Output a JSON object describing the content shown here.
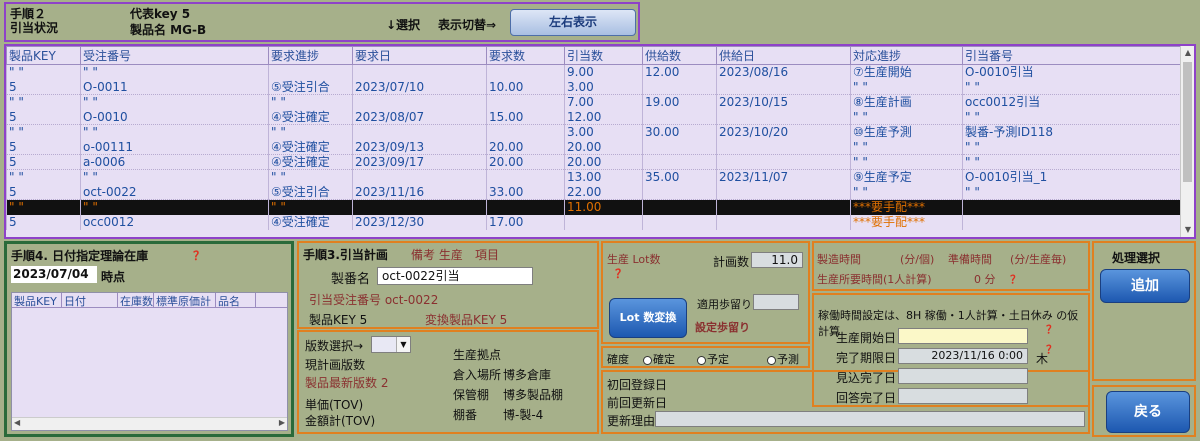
{
  "header": {
    "step_label": "手順２",
    "status_label": "引当状況",
    "rep_key": "代表key 5",
    "product_name": "製品名  MG-B",
    "select_label": "↓選択",
    "display_switch": "表示切替⇒",
    "lr_button": "左右表示"
  },
  "grid": {
    "columns": [
      "製品KEY",
      "受注番号",
      "要求進捗",
      "要求日",
      "要求数",
      "引当数",
      "供給数",
      "供給日",
      "対応進捗",
      "引当番号"
    ],
    "rows": [
      {
        "key": "\" \"",
        "order": "\" \"",
        "prog": "",
        "date": "",
        "qty": "",
        "alloc": "9.00",
        "supply": "12.00",
        "sdate": "2023/08/16",
        "resp": "⑦生産開始",
        "alno": "O-0010引当",
        "sep": false,
        "hl": false
      },
      {
        "key": "5",
        "order": "O-0011",
        "prog": "⑤受注引合",
        "date": "2023/07/10",
        "qty": "10.00",
        "alloc": "3.00",
        "supply": "",
        "sdate": "",
        "resp": "\"  \"",
        "alno": "\"  \"",
        "sep": true,
        "hl": false
      },
      {
        "key": "\"  \"",
        "order": "\" \"",
        "prog": "\" \"",
        "date": "",
        "qty": "",
        "alloc": "7.00",
        "supply": "19.00",
        "sdate": "2023/10/15",
        "resp": "⑧生産計画",
        "alno": "occ0012引当",
        "sep": false,
        "hl": false
      },
      {
        "key": "5",
        "order": "O-0010",
        "prog": "④受注確定",
        "date": "2023/08/07",
        "qty": "15.00",
        "alloc": "12.00",
        "supply": "",
        "sdate": "",
        "resp": "\"  \"",
        "alno": "\"  \"",
        "sep": true,
        "hl": false
      },
      {
        "key": "\"  \"",
        "order": "\" \"",
        "prog": "\" \"",
        "date": "",
        "qty": "",
        "alloc": "3.00",
        "supply": "30.00",
        "sdate": "2023/10/20",
        "resp": "⑩生産予測",
        "alno": "製番-予測ID118",
        "sep": false,
        "hl": false
      },
      {
        "key": "5",
        "order": "o-00111",
        "prog": "④受注確定",
        "date": "2023/09/13",
        "qty": "20.00",
        "alloc": "20.00",
        "supply": "",
        "sdate": "",
        "resp": "\"  \"",
        "alno": "\"  \"",
        "sep": true,
        "hl": false
      },
      {
        "key": "5",
        "order": "a-0006",
        "prog": "④受注確定",
        "date": "2023/09/17",
        "qty": "20.00",
        "alloc": "20.00",
        "supply": "",
        "sdate": "",
        "resp": "\"  \"",
        "alno": "\"  \"",
        "sep": true,
        "hl": false
      },
      {
        "key": "\"  \"",
        "order": "\" \"",
        "prog": "\" \"",
        "date": "",
        "qty": "",
        "alloc": "13.00",
        "supply": "35.00",
        "sdate": "2023/11/07",
        "resp": "⑨生産予定",
        "alno": "O-0010引当_1",
        "sep": false,
        "hl": false
      },
      {
        "key": "5",
        "order": "oct-0022",
        "prog": "⑤受注引合",
        "date": "2023/11/16",
        "qty": "33.00",
        "alloc": "22.00",
        "supply": "",
        "sdate": "",
        "resp": "\"  \"",
        "alno": "\"  \"",
        "sep": true,
        "hl": false
      },
      {
        "key": "\"  \"",
        "order": "\" \"",
        "prog": "\" \"",
        "date": "",
        "qty": "",
        "alloc": "11.00",
        "supply": "",
        "sdate": "",
        "resp": "***要手配***",
        "alno": "",
        "sep": false,
        "hl": true
      },
      {
        "key": "5",
        "order": "occ0012",
        "prog": "④受注確定",
        "date": "2023/12/30",
        "qty": "17.00",
        "alloc": "",
        "supply": "",
        "sdate": "",
        "resp": "***要手配***",
        "alno": "",
        "sep": false,
        "hl": false
      }
    ]
  },
  "step4": {
    "title": "手順4. 日付指定理論在庫",
    "question": "？",
    "date": "2023/07/04",
    "time_point": "時点",
    "list_cols": [
      "製品KEY",
      "日付",
      "在庫数",
      "標準原価計",
      "品名"
    ]
  },
  "step3": {
    "title": "手順3.引当計画",
    "note_label": "備考 生産",
    "item_label": "項目",
    "lot_no_label": "製番名",
    "lot_no_value": "oct-0022引当",
    "alloc_order_no": "引当受注番号 oct-0022",
    "product_key": "製品KEY 5",
    "convert_key": "変換製品KEY 5",
    "version_select": "版数選択→",
    "current_version": "現計画版数",
    "latest_version": "製品最新版数  2",
    "base": "生産拠点",
    "store_label": "倉入場所",
    "store_value": "博多倉庫",
    "shelf_label": "保管棚",
    "shelf_value": "博多製品棚",
    "rack_label": "棚番",
    "rack_value": "博-製-4",
    "unit_price": "単価(TOV)",
    "amount": "金額計(TOV)"
  },
  "plan": {
    "lot_label": "生産 Lot数",
    "question": "？",
    "plan_qty_label": "計画数",
    "plan_qty": "11.0",
    "lot_button": "Lot 数変換",
    "yield_label": "適用歩留り",
    "set_yield": "設定歩留り"
  },
  "certainty": {
    "label": "確度",
    "opts": [
      "確定",
      "予定",
      "予測"
    ]
  },
  "update": {
    "first_reg": "初回登録日",
    "last_upd": "前回更新日",
    "reason": "更新理由"
  },
  "mfg": {
    "time_label": "製造時間",
    "time_unit": "(分/個)",
    "prep_label": "準備時間",
    "prep_unit": "(分/生産毎)",
    "required_label": "生産所要時間(1人計算)",
    "required_value": "0 分",
    "question": "？"
  },
  "sched": {
    "note": "稼働時間設定は、8H 稼働・1人計算・土日休み の仮計算",
    "start_label": "生産開始日",
    "due_label": "完了期限日",
    "due_value": "2023/11/16 0:00",
    "weekday": "木",
    "expected_label": "見込完了日",
    "answer_label": "回答完了日",
    "question": "？"
  },
  "actions": {
    "title": "処理選択",
    "add": "追加",
    "back": "戻る"
  }
}
